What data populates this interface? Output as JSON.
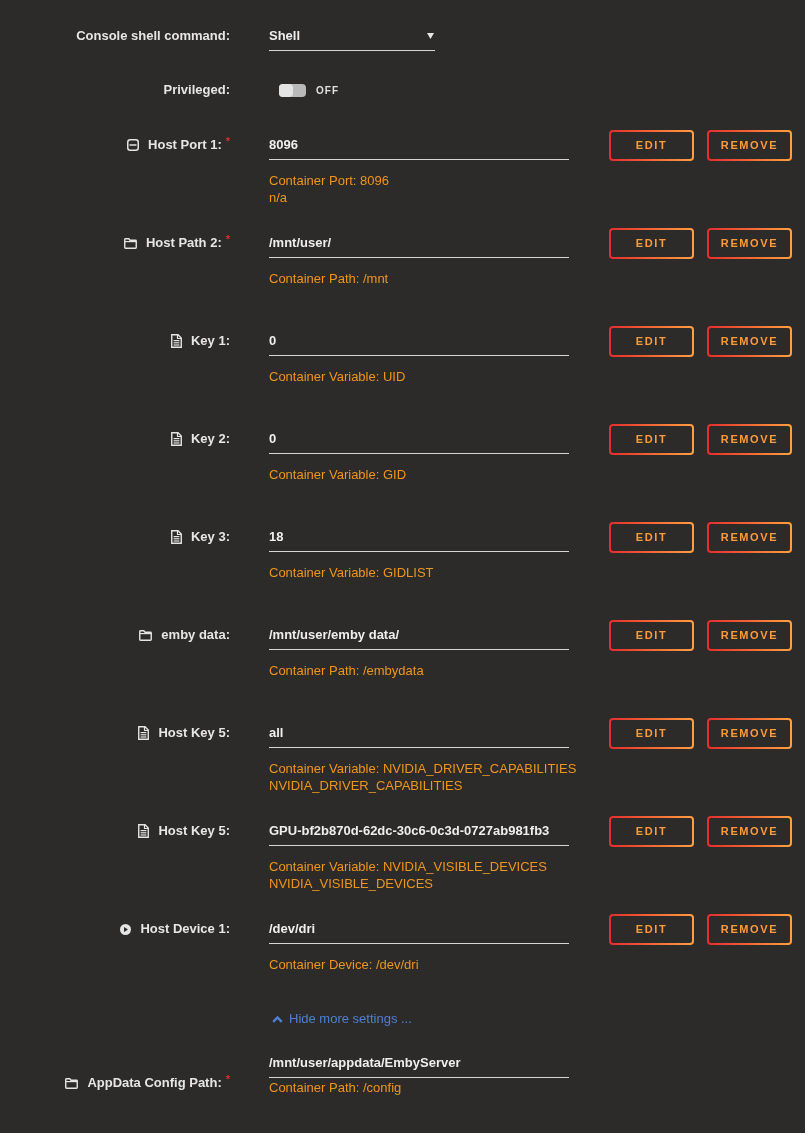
{
  "settings": [
    {
      "kind": "select",
      "label": "Console shell command:",
      "value": "Shell"
    },
    {
      "kind": "toggle",
      "label": "Privileged:",
      "on": false,
      "state_text": "OFF"
    }
  ],
  "mappings": [
    {
      "kind": "port",
      "label": "Host Port 1:",
      "required_mark": "*",
      "value": "8096",
      "description": [
        "Container Port: 8096",
        "n/a"
      ],
      "actions": [
        "EDIT",
        "REMOVE"
      ]
    },
    {
      "kind": "path",
      "label": "Host Path 2:",
      "required_mark": "*",
      "value": "/mnt/user/",
      "description": [
        "Container Path: /mnt"
      ],
      "actions": [
        "EDIT",
        "REMOVE"
      ]
    },
    {
      "kind": "variable",
      "label": "Key 1:",
      "value": "0",
      "description": [
        "Container Variable: UID"
      ],
      "actions": [
        "EDIT",
        "REMOVE"
      ]
    },
    {
      "kind": "variable",
      "label": "Key 2:",
      "value": "0",
      "description": [
        "Container Variable: GID"
      ],
      "actions": [
        "EDIT",
        "REMOVE"
      ]
    },
    {
      "kind": "variable",
      "label": "Key 3:",
      "value": "18",
      "description": [
        "Container Variable: GIDLIST"
      ],
      "actions": [
        "EDIT",
        "REMOVE"
      ]
    },
    {
      "kind": "path",
      "label": "emby data:",
      "value": "/mnt/user/emby data/",
      "description": [
        "Container Path: /embydata"
      ],
      "actions": [
        "EDIT",
        "REMOVE"
      ]
    },
    {
      "kind": "variable",
      "label": "Host Key 5:",
      "value": "all",
      "description": [
        "Container Variable: NVIDIA_DRIVER_CAPABILITIES",
        "NVIDIA_DRIVER_CAPABILITIES"
      ],
      "actions": [
        "EDIT",
        "REMOVE"
      ]
    },
    {
      "kind": "variable",
      "label": "Host Key 5:",
      "value": "GPU-bf2b870d-62dc-30c6-0c3d-0727ab981fb3",
      "description": [
        "Container Variable: NVIDIA_VISIBLE_DEVICES",
        "NVIDIA_VISIBLE_DEVICES"
      ],
      "actions": [
        "EDIT",
        "REMOVE"
      ]
    },
    {
      "kind": "device",
      "label": "Host Device 1:",
      "value": "/dev/dri",
      "description": [
        "Container Device: /dev/dri"
      ],
      "actions": [
        "EDIT",
        "REMOVE"
      ]
    }
  ],
  "more_settings_link": {
    "label": "Hide more settings ...",
    "expanded": true
  },
  "appdata": {
    "kind": "path",
    "label": "AppData Config Path:",
    "required_mark": "*",
    "value": "/mnt/user/appdata/EmbyServer",
    "description": [
      "Container Path: /config"
    ]
  }
}
